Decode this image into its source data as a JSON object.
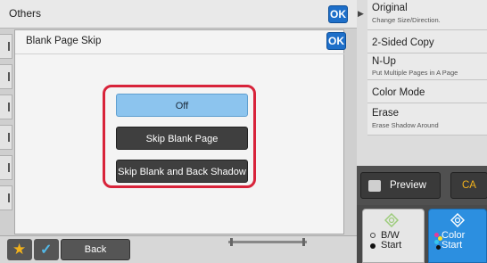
{
  "background_panel": {
    "title": "Others",
    "ok_label": "OK"
  },
  "dialog": {
    "title": "Blank Page Skip",
    "ok_label": "OK",
    "options": [
      {
        "label": "Off",
        "selected": true
      },
      {
        "label": "Skip Blank Page",
        "selected": false
      },
      {
        "label": "Skip Blank and Back Shadow",
        "selected": false
      }
    ]
  },
  "bottom_bar": {
    "back_label": "Back"
  },
  "right_panel": {
    "items": [
      {
        "label": "Original",
        "sub": "Change Size/Direction."
      },
      {
        "label": "2-Sided Copy",
        "sub": ""
      },
      {
        "label": "N-Up",
        "sub": "Put Multiple Pages in A Page"
      },
      {
        "label": "Color Mode",
        "sub": ""
      },
      {
        "label": "Erase",
        "sub": "Erase Shadow Around"
      }
    ],
    "preview_label": "Preview",
    "ca_label": "CA",
    "bw_start": {
      "line1": "B/W",
      "line2": "Start"
    },
    "color_start": {
      "line1": "Color",
      "line2": "Start"
    }
  },
  "icons": {
    "favorite": "star-icon",
    "check": "checkmark-icon",
    "preview": "preview-icon",
    "start": "start-diamond-icon",
    "expand": "chevron-right-icon"
  },
  "colors": {
    "accent_blue": "#1e6fc9",
    "selected_option": "#8cc4ee",
    "highlight_red": "#d8233a",
    "ca_yellow": "#f2b21c",
    "color_start_blue": "#2c8fe0"
  }
}
